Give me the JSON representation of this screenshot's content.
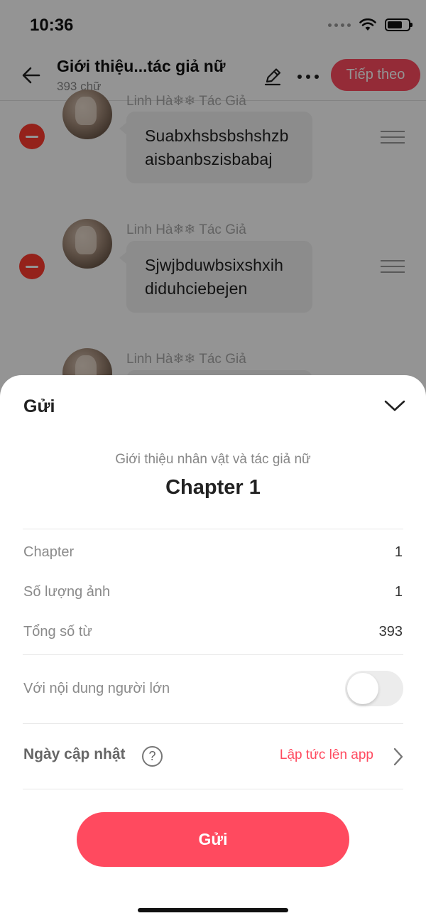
{
  "status_bar": {
    "time": "10:36"
  },
  "header": {
    "title": "Giới thiệu...tác giả nữ",
    "word_count": "393 chữ",
    "next_label": "Tiếp theo"
  },
  "messages": [
    {
      "author": "Linh Hà❄❄ Tác Giả",
      "text_line1": "Suabxhsbsbshshzb",
      "text_line2": "aisbanbszisbabaj"
    },
    {
      "author": "Linh Hà❄❄ Tác Giả",
      "text_line1": "Sjwjbduwbsixshxih",
      "text_line2": "diduhciebejen"
    },
    {
      "author": "Linh Hà❄❄ Tác Giả"
    }
  ],
  "sheet": {
    "title": "Gửi",
    "book_title": "Giới thiệu nhân vật và tác giả nữ",
    "chapter_title": "Chapter 1",
    "stats": [
      {
        "label": "Chapter",
        "value": "1"
      },
      {
        "label": "Số lượng ảnh",
        "value": "1"
      },
      {
        "label": "Tổng số từ",
        "value": "393"
      }
    ],
    "adult_toggle": {
      "label": "Với nội dung người lớn",
      "on": false
    },
    "update_date": {
      "label": "Ngày cập nhật",
      "help": "?",
      "value": "Lập tức lên app"
    },
    "submit_label": "Gửi"
  },
  "colors": {
    "accent": "#ff4a5f",
    "remove": "#ff3b30"
  }
}
